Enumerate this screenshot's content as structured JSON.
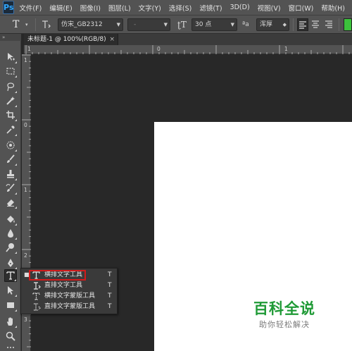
{
  "app": {
    "logo_text": "Ps",
    "menus": [
      "文件(F)",
      "编辑(E)",
      "图像(I)",
      "图层(L)",
      "文字(Y)",
      "选择(S)",
      "滤镜(T)",
      "3D(D)",
      "视图(V)",
      "窗口(W)",
      "帮助(H)"
    ]
  },
  "options_bar": {
    "tool_glyph": "T",
    "font_family": "仿宋_GB2312",
    "font_style": "-",
    "font_size": "30 点",
    "aa_glyph": "ªa",
    "antialias": "浑厚"
  },
  "document": {
    "tab_title": "未标题-1 @ 100%(RGB/8)",
    "close_glyph": "×"
  },
  "rulers": {
    "top_labels": [
      "1",
      "0",
      "1"
    ],
    "left_labels": [
      "1",
      "0",
      "1",
      "2",
      "3"
    ]
  },
  "toolbox": {
    "grip": "»",
    "tools": [
      "move-tool",
      "marquee-tool",
      "lasso-tool",
      "magic-wand-tool",
      "crop-tool",
      "eyedropper-tool",
      "healing-brush-tool",
      "brush-tool",
      "clone-stamp-tool",
      "history-brush-tool",
      "eraser-tool",
      "paint-bucket-tool",
      "blur-tool",
      "dodge-tool",
      "pen-tool",
      "type-tool",
      "path-selection-tool",
      "rectangle-tool",
      "hand-tool",
      "zoom-tool"
    ],
    "active_tool": "type-tool"
  },
  "type_flyout": {
    "items": [
      {
        "label": "横排文字工具",
        "shortcut": "T",
        "selected": true,
        "icon": "horizontal-type-icon"
      },
      {
        "label": "直排文字工具",
        "shortcut": "T",
        "selected": false,
        "icon": "vertical-type-icon"
      },
      {
        "label": "横排文字蒙版工具",
        "shortcut": "T",
        "selected": false,
        "icon": "horizontal-type-mask-icon"
      },
      {
        "label": "直排文字蒙版工具",
        "shortcut": "T",
        "selected": false,
        "icon": "vertical-type-mask-icon"
      }
    ],
    "highlight_color": "#d21b1b"
  },
  "watermark": {
    "title": "百科全说",
    "subtitle": "助你轻松解决",
    "color": "#1f9a36"
  }
}
